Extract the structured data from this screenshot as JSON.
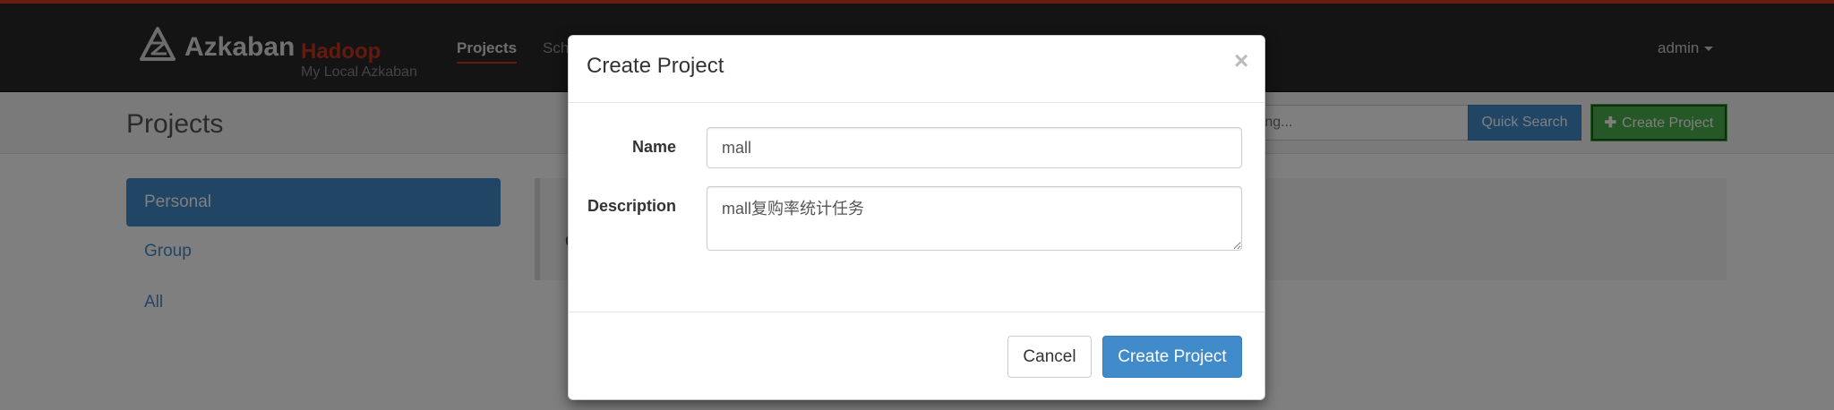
{
  "navbar": {
    "brand": "Azkaban",
    "environment": "Hadoop",
    "subtitle": "My Local Azkaban",
    "links": [
      "Projects",
      "Sch"
    ],
    "user": "admin",
    "accent_color": "#c9361f"
  },
  "header": {
    "title": "Projects",
    "search_placeholder": "taining...",
    "quick_search_label": "Quick Search",
    "create_project_label": "Create Project",
    "create_project_icon": "plus-icon"
  },
  "sidebar": {
    "items": [
      {
        "label": "Personal",
        "active": true
      },
      {
        "label": "Group",
        "active": false
      },
      {
        "label": "All",
        "active": false
      }
    ]
  },
  "main": {
    "panel_char": "C"
  },
  "modal": {
    "title": "Create Project",
    "close_glyph": "×",
    "name_label": "Name",
    "name_value": "mall",
    "description_label": "Description",
    "description_value": "mall复购率统计任务",
    "cancel_label": "Cancel",
    "submit_label": "Create Project"
  }
}
